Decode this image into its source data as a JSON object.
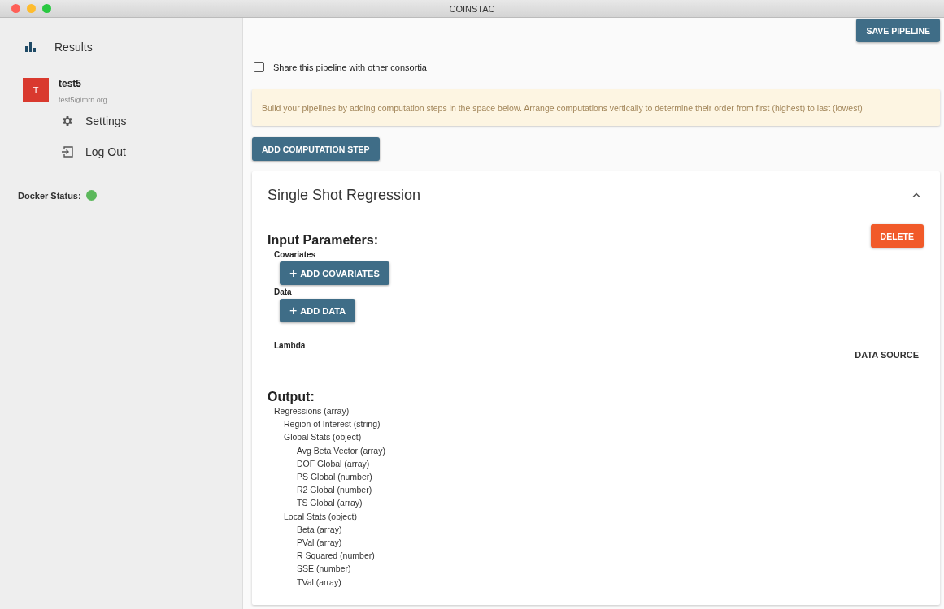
{
  "window": {
    "title": "COINSTAC"
  },
  "sidebar": {
    "items": [
      {
        "label": "Results",
        "kind": "results"
      }
    ],
    "user": {
      "initial": "T",
      "name": "test5",
      "email": "test5@mrn.org"
    },
    "user_menu": [
      {
        "label": "Settings",
        "kind": "settings"
      },
      {
        "label": "Log Out",
        "kind": "logout"
      }
    ],
    "docker_status": {
      "label": "Docker Status:",
      "color": "#5cb85c"
    }
  },
  "main": {
    "save_button": "SAVE PIPELINE",
    "share": {
      "label": "Share this pipeline with other consortia",
      "checked": false
    },
    "info": "Build your pipelines by adding computation steps in the space below. Arrange computations vertically to determine their order from first (highest) to last (lowest)",
    "add_step_button": "ADD COMPUTATION STEP",
    "step": {
      "title": "Single Shot Regression",
      "expanded": true,
      "input_heading": "Input Parameters:",
      "delete_button": "DELETE",
      "inputs": [
        {
          "kind": "button",
          "label": "Covariates",
          "button": "ADD COVARIATES",
          "plus": "+"
        },
        {
          "kind": "button",
          "label": "Data",
          "button": "ADD DATA",
          "plus": "+"
        },
        {
          "kind": "field",
          "label": "Lambda"
        }
      ],
      "data_source": "DATA SOURCE",
      "output_heading": "Output:",
      "outputs": [
        {
          "label": "Regressions (array)",
          "children": [
            {
              "label": "Region of Interest (string)"
            },
            {
              "label": "Global Stats (object)",
              "children": [
                {
                  "label": "Avg Beta Vector (array)"
                },
                {
                  "label": "DOF Global (array)"
                },
                {
                  "label": "PS Global (number)"
                },
                {
                  "label": "R2 Global (number)"
                },
                {
                  "label": "TS Global (array)"
                }
              ]
            },
            {
              "label": "Local Stats (object)",
              "children": [
                {
                  "label": "Beta (array)"
                },
                {
                  "label": "PVal (array)"
                },
                {
                  "label": "R Squared (number)"
                },
                {
                  "label": "SSE (number)"
                },
                {
                  "label": "TVal (array)"
                }
              ]
            }
          ]
        }
      ]
    }
  }
}
